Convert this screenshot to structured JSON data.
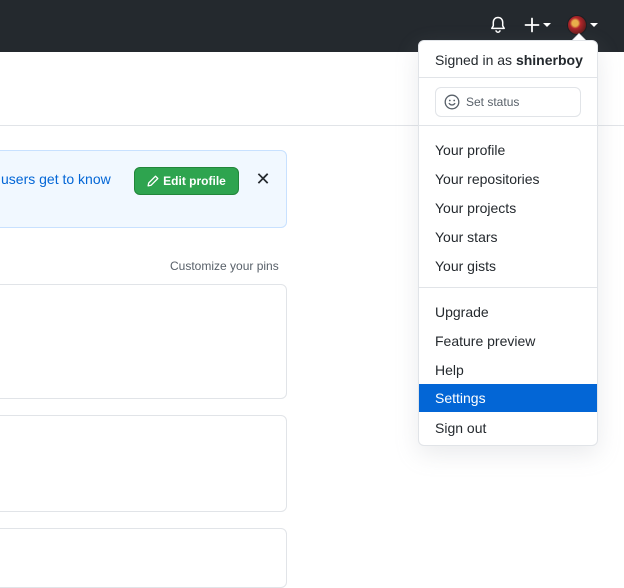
{
  "header": {
    "notifications_icon": "bell-icon",
    "create_icon": "plus-icon",
    "avatar_icon": "user-avatar"
  },
  "banner": {
    "text": "users get to know",
    "edit_profile_label": "Edit profile",
    "close_label": "✕"
  },
  "pins": {
    "customize_label": "Customize your pins"
  },
  "user_menu": {
    "signed_in_prefix": "Signed in as",
    "username": "shinerboy",
    "set_status_label": "Set status",
    "items": [
      {
        "label": "Your profile"
      },
      {
        "label": "Your repositories"
      },
      {
        "label": "Your projects"
      },
      {
        "label": "Your stars"
      },
      {
        "label": "Your gists"
      },
      {
        "label": "Upgrade"
      },
      {
        "label": "Feature preview"
      },
      {
        "label": "Help"
      },
      {
        "label": "Settings",
        "active": true
      },
      {
        "label": "Sign out"
      }
    ],
    "active_color": "#0366d6"
  }
}
